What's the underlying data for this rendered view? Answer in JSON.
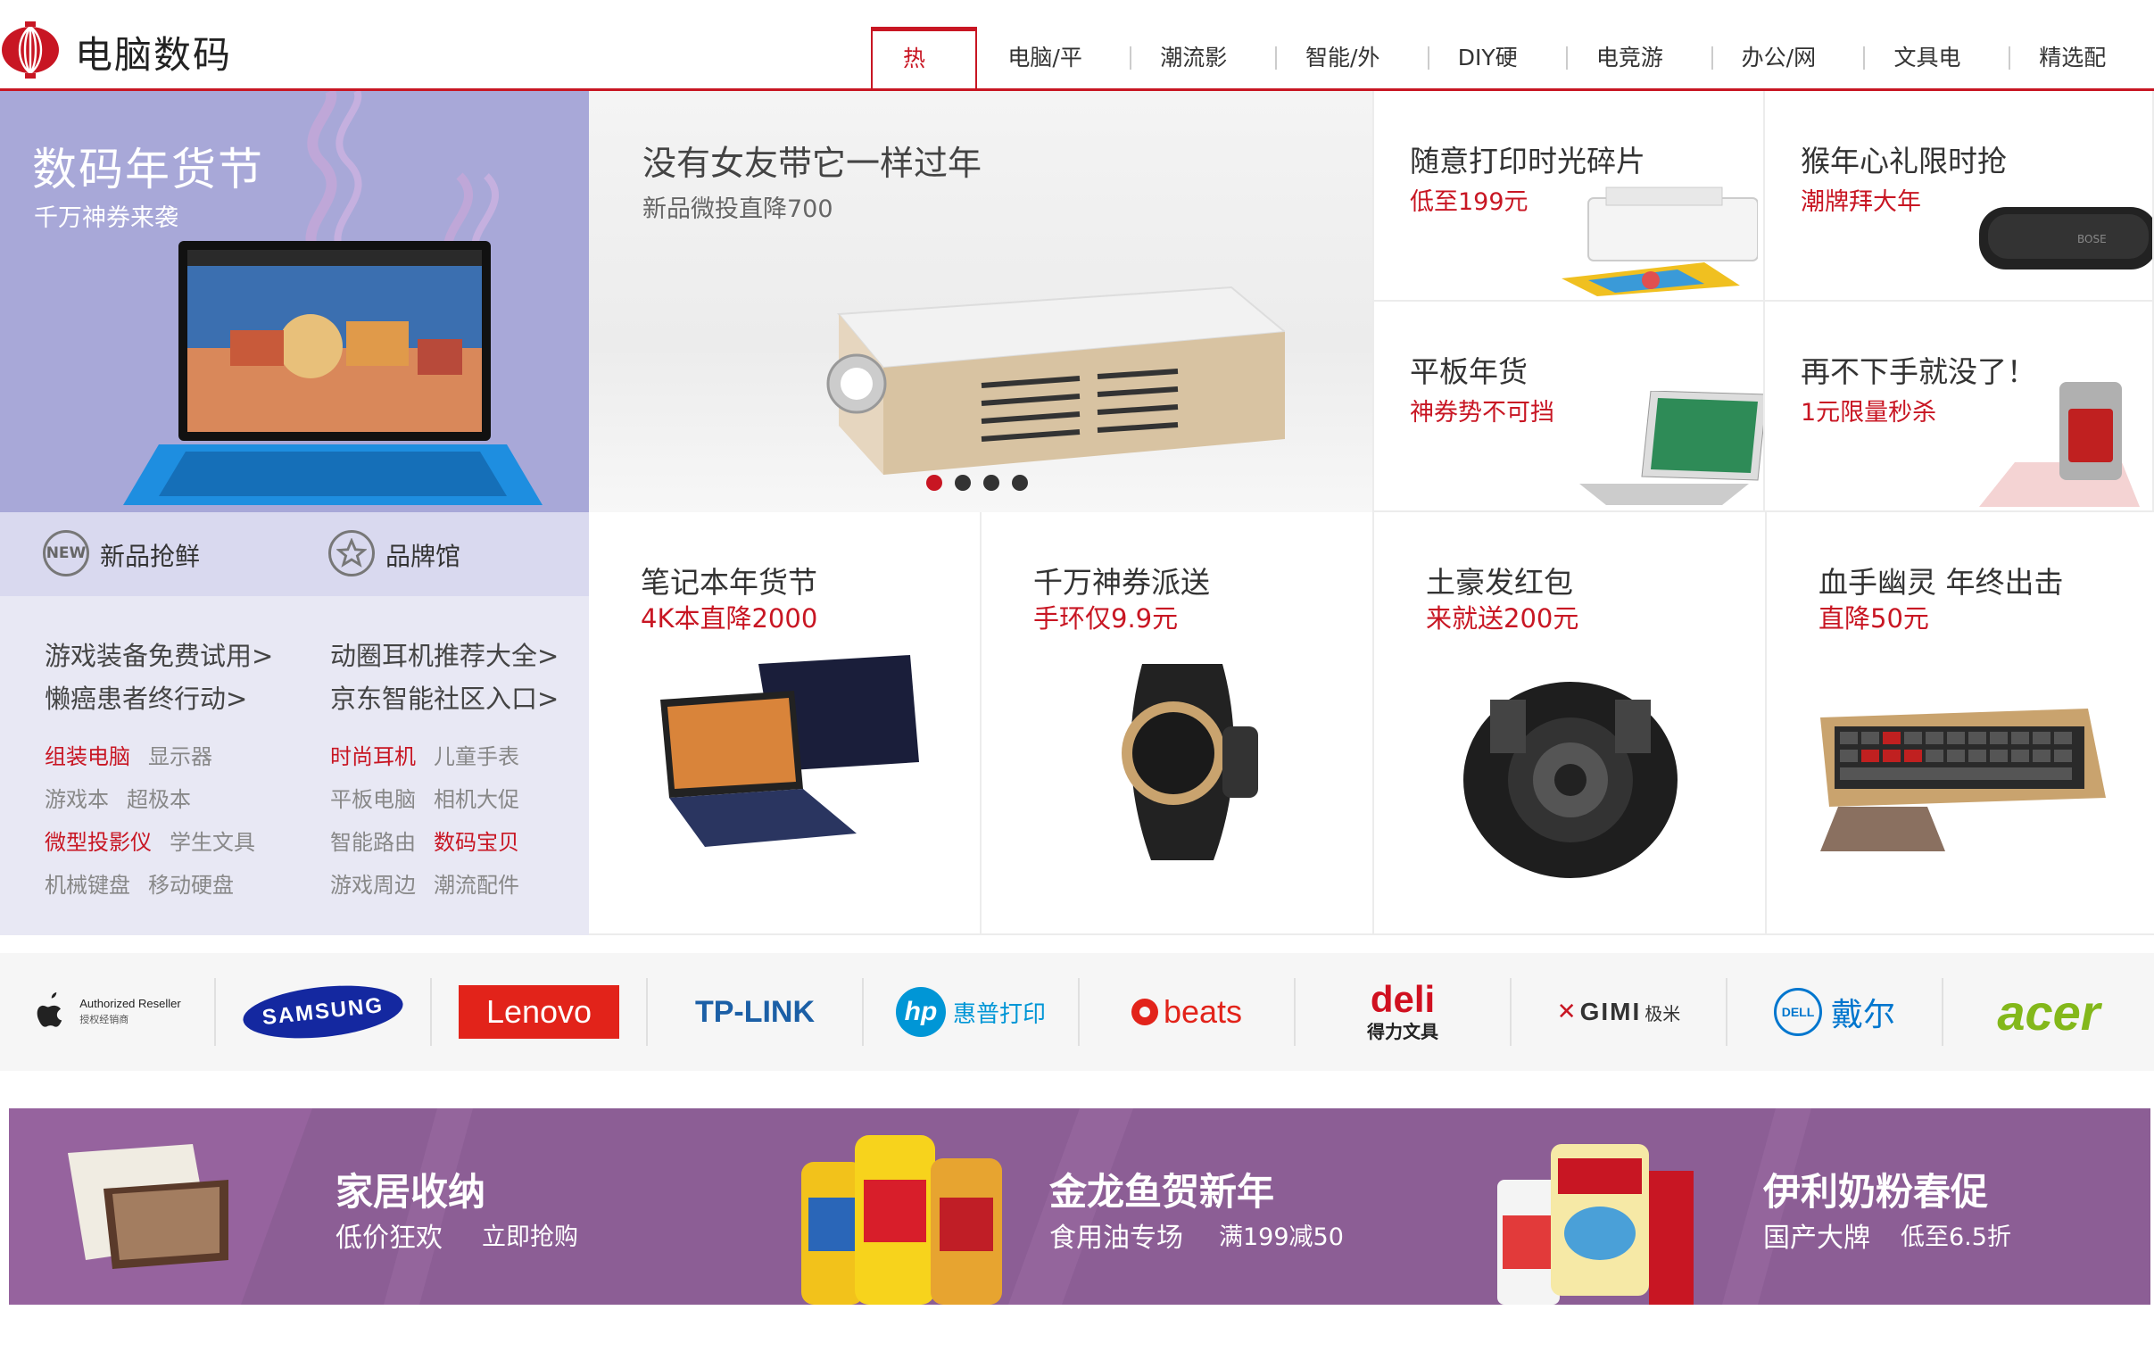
{
  "header": {
    "title": "电脑数码",
    "tabs": [
      "热门",
      "电脑/平板",
      "潮流影音",
      "智能/外设",
      "DIY硬件",
      "电竞游戏",
      "办公/网络",
      "文具电教",
      "精选配件"
    ],
    "active_tab": 0
  },
  "hero": {
    "left": {
      "title": "数码年货节",
      "subtitle": "千万神券来袭"
    },
    "center": {
      "title": "没有女友带它一样过年",
      "subtitle": "新品微投直降700",
      "slides": 4,
      "active_slide": 0
    },
    "promos": [
      {
        "title": "随意打印时光碎片",
        "sub": "低至199元"
      },
      {
        "title": "猴年心礼限时抢",
        "sub": "潮牌拜大年"
      },
      {
        "title": "平板年货",
        "sub": "神券势不可挡"
      },
      {
        "title": "再不下手就没了！",
        "sub": "1元限量秒杀"
      }
    ]
  },
  "side": {
    "new_badge": "NEW",
    "new_label": "新品抢鲜",
    "brand_label": "品牌馆",
    "big_links": [
      "游戏装备免费试用>",
      "动圈耳机推荐大全>",
      "懒癌患者终行动>",
      "京东智能社区入口>"
    ],
    "small_links": [
      [
        "组装电脑",
        "显示器",
        "时尚耳机",
        "儿童手表"
      ],
      [
        "游戏本",
        "超极本",
        "平板电脑",
        "相机大促"
      ],
      [
        "微型投影仪",
        "学生文具",
        "智能路由",
        "数码宝贝"
      ],
      [
        "机械键盘",
        "移动硬盘",
        "游戏周边",
        "潮流配件"
      ]
    ],
    "red_links": [
      "组装电脑",
      "时尚耳机",
      "微型投影仪",
      "数码宝贝"
    ]
  },
  "products": [
    {
      "title": "笔记本年货节",
      "sub": "4K本直降2000"
    },
    {
      "title": "千万神券派送",
      "sub": "手环仅9.9元"
    },
    {
      "title": "土豪发红包",
      "sub": "来就送200元"
    },
    {
      "title": "血手幽灵 年终出击",
      "sub": "直降50元"
    }
  ],
  "brands": {
    "apple": {
      "line1": "Authorized Reseller",
      "line2": "授权经销商"
    },
    "samsung": "SAMSUNG",
    "lenovo": "Lenovo",
    "tplink": "TP-LINK",
    "hp": {
      "mark": "hp",
      "text": "惠普打印"
    },
    "beats": "beats",
    "deli": {
      "mark": "deli",
      "text": "得力文具"
    },
    "gimi": {
      "mark": "GIMI",
      "text": "极米"
    },
    "dell": {
      "mark": "DELL",
      "text": "戴尔"
    },
    "acer": "acer"
  },
  "bottom": [
    {
      "title": "家居收纳",
      "sub1": "低价狂欢",
      "sub2": "立即抢购"
    },
    {
      "title": "金龙鱼贺新年",
      "sub1": "食用油专场",
      "sub2": "满199减50"
    },
    {
      "title": "伊利奶粉春促",
      "sub1": "国产大牌",
      "sub2": "低至6.5折"
    }
  ],
  "colors": {
    "accent": "#c81623",
    "lavender": "#a8a8d8",
    "banner": "#8c5e95"
  }
}
